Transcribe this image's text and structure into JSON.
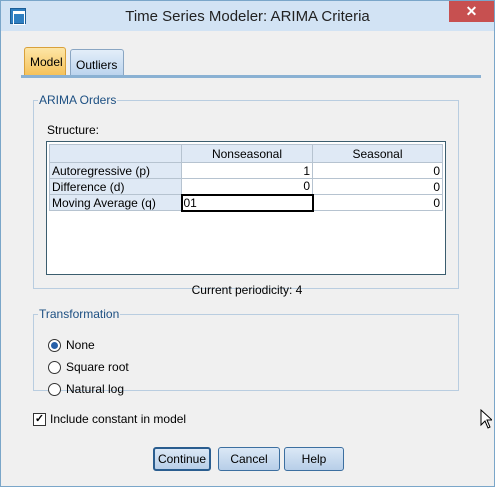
{
  "window": {
    "title": "Time Series Modeler: ARIMA Criteria",
    "close_glyph": "✕"
  },
  "tabs": [
    {
      "label": "Model",
      "selected": true
    },
    {
      "label": "Outliers",
      "selected": false
    }
  ],
  "arima": {
    "legend": "ARIMA Orders",
    "structure_label": "Structure:",
    "columns": [
      "",
      "Nonseasonal",
      "Seasonal"
    ],
    "rows": [
      {
        "label": "Autoregressive (p)",
        "nonseasonal": "1",
        "seasonal": "0"
      },
      {
        "label": "Difference (d)",
        "nonseasonal": "0",
        "seasonal": "0"
      },
      {
        "label": "Moving Average (q)",
        "nonseasonal": "01",
        "seasonal": "0"
      }
    ],
    "periodicity": "Current periodicity: 4"
  },
  "transformation": {
    "legend": "Transformation",
    "options": [
      {
        "label": "None",
        "checked": true
      },
      {
        "label": "Square root",
        "checked": false
      },
      {
        "label": "Natural log",
        "checked": false
      }
    ]
  },
  "include_constant": {
    "label": "Include constant in model",
    "checked": true,
    "glyph": "✓"
  },
  "buttons": {
    "continue": "Continue",
    "cancel": "Cancel",
    "help": "Help"
  },
  "colors": {
    "title_bar": "#d2e3f4",
    "close": "#c75050",
    "selected_tab": "#f5c25b",
    "accent": "#2760a8"
  }
}
